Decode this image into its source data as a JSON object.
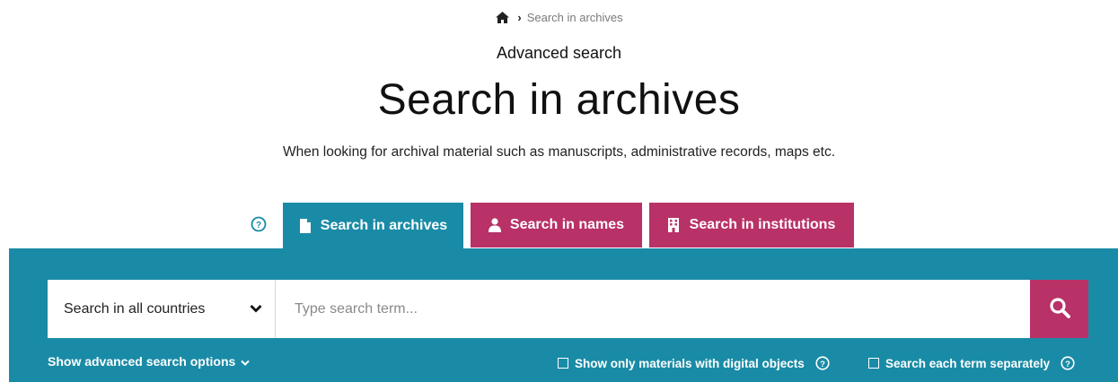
{
  "breadcrumb": {
    "home_icon": "home-icon",
    "separator_icon": "chevron-right-icon",
    "current": "Search in archives"
  },
  "header": {
    "eyebrow": "Advanced search",
    "title": "Search in archives",
    "subtitle": "When looking for archival material such as manuscripts, administrative records, maps etc."
  },
  "tabs": [
    {
      "label": "Search in archives",
      "icon": "document-icon",
      "active": true
    },
    {
      "label": "Search in names",
      "icon": "person-icon",
      "active": false
    },
    {
      "label": "Search in institutions",
      "icon": "building-icon",
      "active": false
    }
  ],
  "search": {
    "country_select": "Search in all countries",
    "placeholder": "Type search term...",
    "value": "",
    "button_icon": "search-icon"
  },
  "options": {
    "advanced_toggle": "Show advanced search options",
    "digital_objects": {
      "label": "Show only materials with digital objects",
      "checked": false
    },
    "separate_terms": {
      "label": "Search each term separately",
      "checked": false
    }
  },
  "colors": {
    "teal": "#1a8ba6",
    "magenta": "#b83167"
  }
}
